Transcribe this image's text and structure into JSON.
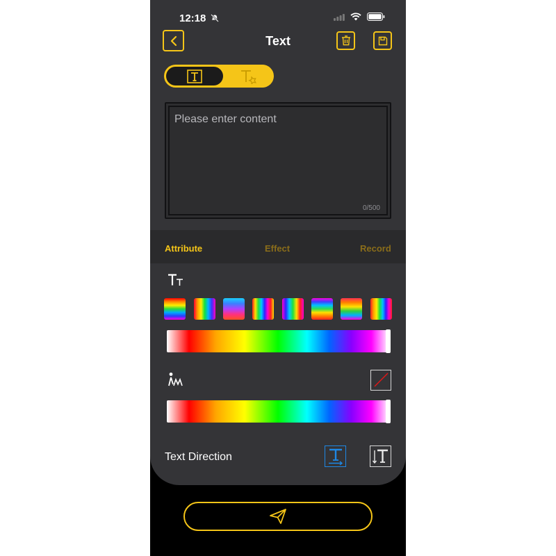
{
  "status": {
    "time": "12:18"
  },
  "header": {
    "title": "Text"
  },
  "editor": {
    "placeholder": "Please enter content",
    "counter": "0/500"
  },
  "tabs": [
    {
      "label": "Attribute",
      "active": true
    },
    {
      "label": "Effect",
      "active": false
    },
    {
      "label": "Record",
      "active": false
    }
  ],
  "attribute": {
    "font_color_icon": "font-size-icon",
    "shadow_icon": "shadow-figure-icon",
    "text_direction_label": "Text Direction",
    "selected_direction": "horizontal"
  },
  "colors": {
    "accent": "#f5c518",
    "panel": "#343437",
    "selected_blue": "#1e88e5"
  }
}
